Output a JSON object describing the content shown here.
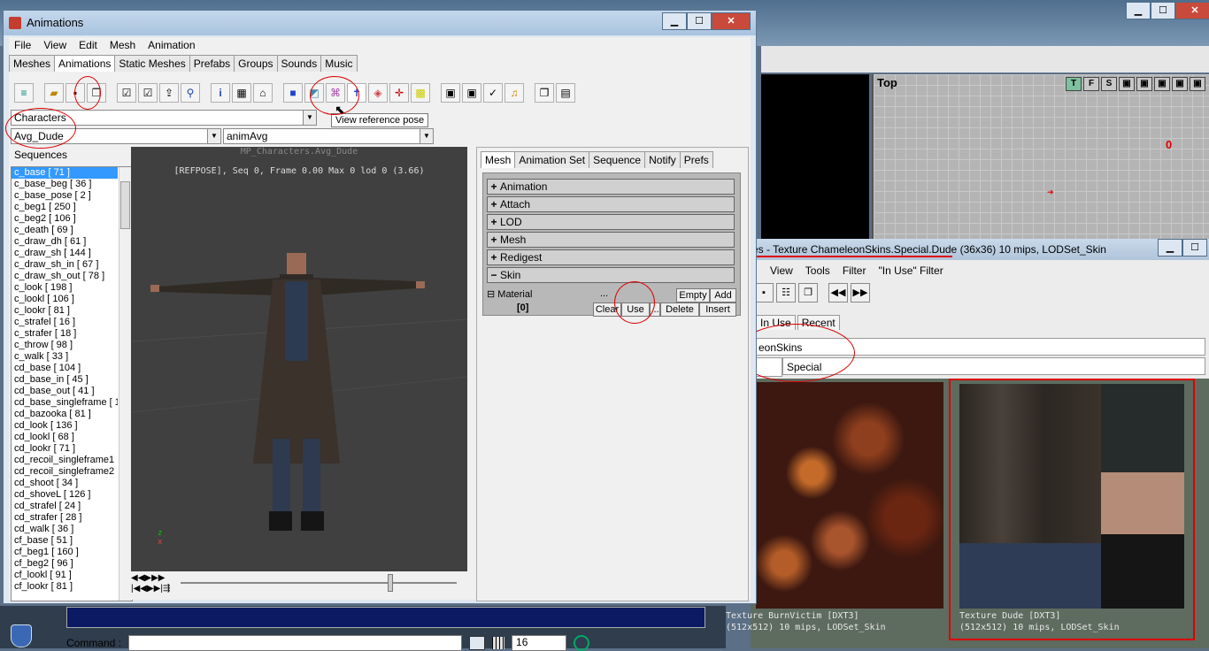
{
  "main_window": {
    "title": "Animations",
    "controls": {
      "minimize": "▁",
      "maximize": "☐",
      "close": "✕"
    },
    "menu": [
      "File",
      "View",
      "Edit",
      "Mesh",
      "Animation"
    ],
    "tabs": [
      "Meshes",
      "Animations",
      "Static Meshes",
      "Prefabs",
      "Groups",
      "Sounds",
      "Music"
    ],
    "active_tab": "Animations",
    "toolbar_icons": [
      "new-package-icon",
      "open-icon",
      "save-icon",
      "copy-icon",
      "checkmark-doc-icon",
      "checkmark-doc2-icon",
      "import-icon",
      "link-icon",
      "info-icon",
      "mesh-props-icon",
      "home-icon",
      "cube-icon",
      "wire-icon",
      "bones-icon",
      "reference-pose-icon",
      "bone-name-icon",
      "crosshair-icon",
      "texture-icon",
      "export-icon",
      "export2-icon",
      "check-icon",
      "sound-icon",
      "copy2-icon",
      "paste-icon"
    ],
    "tooltip": "View reference pose",
    "class_combo": "Characters",
    "mesh_combo": "Avg_Dude",
    "anim_combo": "animAvg",
    "sequences_label": "Sequences",
    "sequences": [
      "c_base [ 71 ]",
      "c_base_beg [ 36 ]",
      "c_base_pose [ 2 ]",
      "c_beg1 [ 250 ]",
      "c_beg2 [ 106 ]",
      "c_death [ 69 ]",
      "c_draw_dh [ 61 ]",
      "c_draw_sh [ 144 ]",
      "c_draw_sh_in [ 67 ]",
      "c_draw_sh_out [ 78 ]",
      "c_look [ 198 ]",
      "c_lookl [ 106 ]",
      "c_lookr [ 81 ]",
      "c_strafel [ 16 ]",
      "c_strafer [ 18 ]",
      "c_throw [ 98 ]",
      "c_walk [ 33 ]",
      "cd_base [ 104 ]",
      "cd_base_in [ 45 ]",
      "cd_base_out [ 41 ]",
      "cd_base_singleframe [ 1",
      "cd_bazooka [ 81 ]",
      "cd_look [ 136 ]",
      "cd_lookl [ 68 ]",
      "cd_lookr [ 71 ]",
      "cd_recoil_singleframe1",
      "cd_recoil_singleframe2",
      "cd_shoot [ 34 ]",
      "cd_shoveL [ 126 ]",
      "cd_strafel [ 24 ]",
      "cd_strafer [ 28 ]",
      "cd_walk [ 36 ]",
      "cf_base [ 51 ]",
      "cf_beg1 [ 160 ]",
      "cf_beg2 [ 96 ]",
      "cf_lookl [ 91 ]",
      "cf_lookr [ 81 ]"
    ],
    "selected_sequence": "c_base [ 71 ]",
    "viewport_title": "MP_Characters.Avg_Dude",
    "viewport_info": "[REFPOSE], Seq 0, Frame  0.00 Max 0  lod 0 (3.66)",
    "axis_z": "z",
    "axis_x": "x",
    "props_tabs": [
      "Mesh",
      "Animation Set",
      "Sequence",
      "Notify",
      "Prefs"
    ],
    "categories": [
      {
        "label": "Animation",
        "sign": "+"
      },
      {
        "label": "Attach",
        "sign": "+"
      },
      {
        "label": "LOD",
        "sign": "+"
      },
      {
        "label": "Mesh",
        "sign": "+"
      },
      {
        "label": "Redigest",
        "sign": "+"
      },
      {
        "label": "Skin",
        "sign": "−"
      }
    ],
    "material_label": "Material",
    "material_sign": "⊟",
    "material_dots": "...",
    "material_index": "[0]",
    "buttons": {
      "empty": "Empty",
      "add": "Add",
      "clear": "Clear",
      "use": "Use",
      "ellipsis": "...",
      "delete": "Delete",
      "insert": "Insert"
    }
  },
  "background_editor": {
    "viewport_label": "Top",
    "viewport_buttons": [
      "T",
      "F",
      "S"
    ],
    "red_marker": "0",
    "command_label": "Command :",
    "grid_size": "16"
  },
  "texture_browser": {
    "title": "es - Texture ChameleonSkins.Special.Dude (36x36) 10 mips, LODSet_Skin",
    "menu": [
      "View",
      "Tools",
      "Filter",
      "\"In Use\" Filter"
    ],
    "tabs": [
      "In Use",
      "Recent"
    ],
    "package": "eonSkins",
    "group": "Special",
    "textures": [
      {
        "line1": "Texture BurnVictim [DXT3]",
        "line2": "(512x512) 10 mips, LODSet_Skin"
      },
      {
        "line1": "Texture Dude [DXT3]",
        "line2": "(512x512) 10 mips, LODSet_Skin"
      }
    ]
  },
  "colors": {
    "annotation": "#dd0000",
    "selection": "#3399ff"
  }
}
